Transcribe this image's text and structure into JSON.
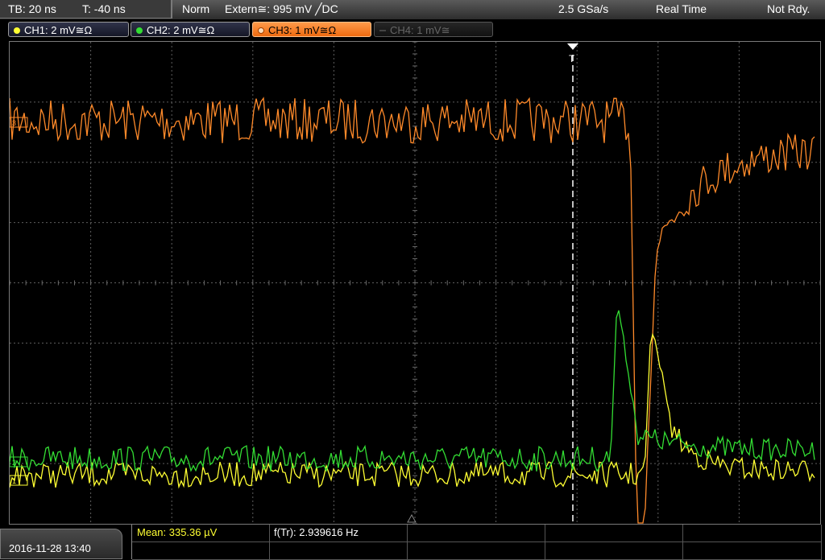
{
  "status": {
    "timebase": "TB: 20 ns",
    "trigger_time": "T: -40 ns",
    "mode": "Norm",
    "trigger_source": "Extern≅: 995 mV ╱DC",
    "sample_rate": "2.5 GSa/s",
    "acq_mode": "Real Time",
    "state": "Not Rdy."
  },
  "channels": [
    {
      "label": "CH1: 2 mV≅Ω",
      "color": "#ffff33"
    },
    {
      "label": "CH2: 2 mV≅Ω",
      "color": "#33dd33"
    },
    {
      "label": "CH3: 1 mV≅Ω",
      "color": "#ff8a2a"
    },
    {
      "label": "CH4: 1 mV≅",
      "color": "#666666"
    }
  ],
  "trigger_marker": "T",
  "measurements": {
    "mean": "Mean: 335.36 µV",
    "freq": "f(Tr): 2.939616 Hz"
  },
  "datetime": "2016-11-28 13:40",
  "colors": {
    "ch1": "#ffff33",
    "ch2": "#33dd33",
    "ch3": "#ff8a2a",
    "grid": "#6a6a6a"
  }
}
